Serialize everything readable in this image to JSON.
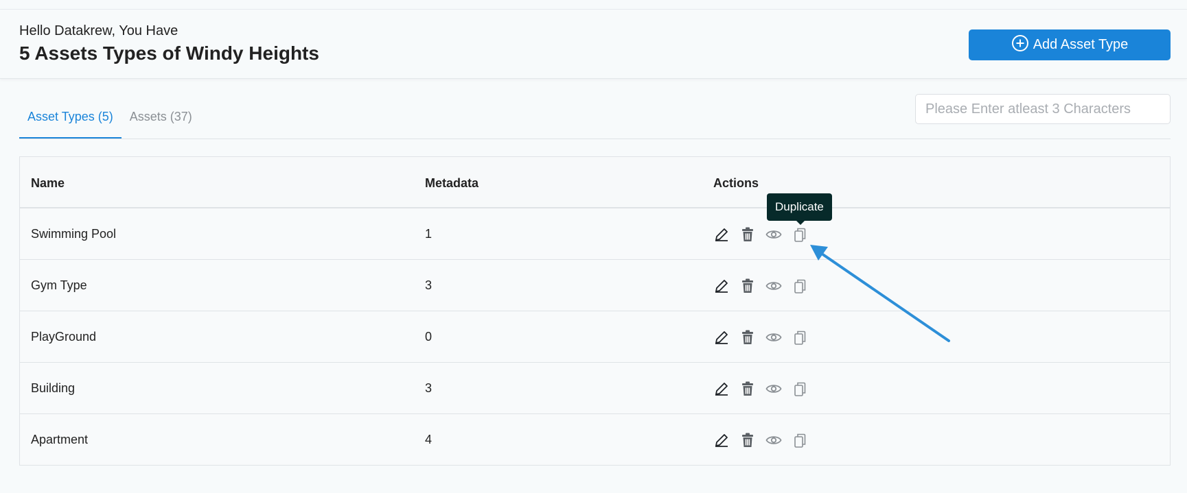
{
  "header": {
    "greeting": "Hello Datakrew, You Have",
    "title": "5 Assets Types of Windy Heights",
    "add_button_label": "Add Asset Type"
  },
  "tabs": [
    {
      "label": "Asset Types (5)",
      "active": true
    },
    {
      "label": "Assets (37)",
      "active": false
    }
  ],
  "search": {
    "placeholder": "Please Enter atleast 3 Characters",
    "value": ""
  },
  "table": {
    "columns": [
      "Name",
      "Metadata",
      "Actions"
    ],
    "rows": [
      {
        "name": "Swimming Pool",
        "metadata": "1"
      },
      {
        "name": "Gym Type",
        "metadata": "3"
      },
      {
        "name": "PlayGround",
        "metadata": "0"
      },
      {
        "name": "Building",
        "metadata": "3"
      },
      {
        "name": "Apartment",
        "metadata": "4"
      }
    ],
    "actions": [
      "edit-icon",
      "delete-icon",
      "view-icon",
      "duplicate-icon"
    ]
  },
  "tooltip": {
    "text": "Duplicate"
  },
  "colors": {
    "accent": "#1a84d9",
    "tooltip_bg": "#072a2a",
    "annotation_arrow": "#2d8fd8"
  }
}
